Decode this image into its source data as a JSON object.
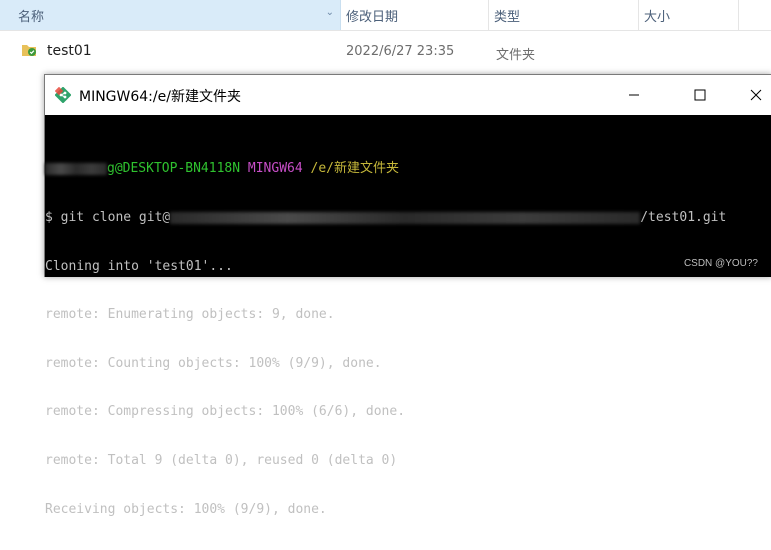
{
  "explorer": {
    "columns": {
      "name": "名称",
      "date": "修改日期",
      "type": "类型",
      "size": "大小"
    },
    "rows": [
      {
        "name": "test01",
        "date": "2022/6/27 23:35",
        "type": "文件夹"
      }
    ]
  },
  "terminal_window": {
    "title": "MINGW64:/e/新建文件夹",
    "prompt": {
      "user_host": "g@DESKTOP-BN4118N",
      "env": "MINGW64",
      "path": "/e/新建文件夹"
    },
    "command_prefix": "$ git clone git@",
    "command_suffix": "/test01.git",
    "output": [
      "Cloning into 'test01'...",
      "remote: Enumerating objects: 9, done.",
      "remote: Counting objects: 100% (9/9), done.",
      "remote: Compressing objects: 100% (6/6), done.",
      "remote: Total 9 (delta 0), reused 0 (delta 0)",
      "Receiving objects: 100% (9/9), done."
    ]
  },
  "watermark": "CSDN @YOU??",
  "colors": {
    "header_selected": "#d9ebf9",
    "terminal_bg": "#000000",
    "prompt_green": "#2fc22f",
    "prompt_magenta": "#c74ec7",
    "prompt_yellow": "#c6b83a"
  }
}
